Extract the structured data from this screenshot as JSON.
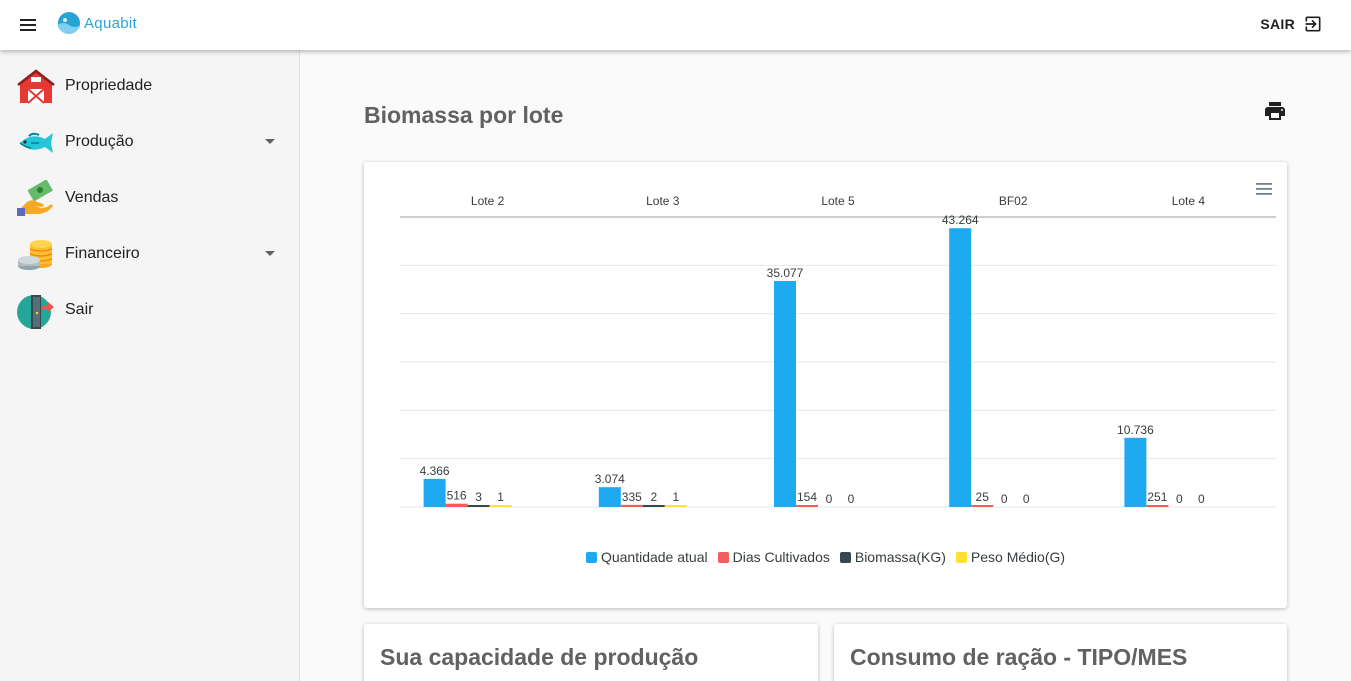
{
  "header": {
    "brand": "Aquabit",
    "logout_label": "SAIR"
  },
  "sidebar": {
    "items": [
      {
        "label": "Propriedade",
        "icon": "barn-icon",
        "expandable": false
      },
      {
        "label": "Produção",
        "icon": "fish-icon",
        "expandable": true
      },
      {
        "label": "Vendas",
        "icon": "money-hand-icon",
        "expandable": false
      },
      {
        "label": "Financeiro",
        "icon": "coins-icon",
        "expandable": true
      },
      {
        "label": "Sair",
        "icon": "exit-door-icon",
        "expandable": false
      }
    ]
  },
  "main": {
    "title": "Biomassa por lote",
    "cards": [
      {
        "title": "Sua capacidade de produção"
      },
      {
        "title": "Consumo de ração - TIPO/MES"
      }
    ]
  },
  "colors": {
    "quantidade": "#1eaaf1",
    "dias": "#f45d5d",
    "biomassa": "#37474f",
    "peso": "#ffe033",
    "accent": "#29a3d6"
  },
  "chart_data": {
    "type": "bar",
    "categories": [
      "Lote 2",
      "Lote 3",
      "Lote 5",
      "BF02",
      "Lote 4"
    ],
    "x_axis_position": "top",
    "ylim": [
      0,
      45000
    ],
    "grid": true,
    "legend_position": "bottom",
    "series": [
      {
        "name": "Quantidade atual",
        "values": [
          4366,
          3074,
          35077,
          43264,
          10736
        ],
        "labels": [
          "4.366",
          "3.074",
          "35.077",
          "43.264",
          "10.736"
        ]
      },
      {
        "name": "Dias Cultivados",
        "values": [
          516,
          335,
          154,
          25,
          251
        ],
        "labels": [
          "516",
          "335",
          "154",
          "25",
          "251"
        ]
      },
      {
        "name": "Biomassa(KG)",
        "values": [
          3,
          2,
          0,
          0,
          0
        ],
        "labels": [
          "3",
          "2",
          "0",
          "0",
          "0"
        ]
      },
      {
        "name": "Peso Médio(G)",
        "values": [
          1,
          1,
          0,
          0,
          0
        ],
        "labels": [
          "1",
          "1",
          "0",
          "0",
          "0"
        ]
      }
    ]
  }
}
